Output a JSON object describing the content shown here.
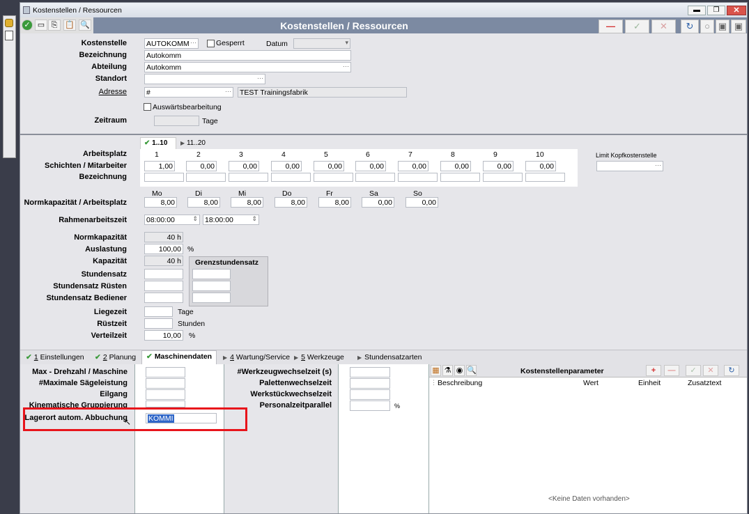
{
  "window": {
    "title": "Kostenstellen / Ressourcen",
    "header_title": "Kostenstellen / Ressourcen"
  },
  "colors": {
    "header_bg": "#7c8aa2",
    "panel_bg": "#e6e6ea",
    "accent_green": "#3a9a3a",
    "accent_red": "#d33030",
    "highlight_box": "#e8141b"
  },
  "form": {
    "kostenstelle_label": "Kostenstelle",
    "kostenstelle_value": "AUTOKOMM",
    "gesperrt_label": "Gesperrt",
    "datum_label": "Datum",
    "bezeichnung_label": "Bezeichnung",
    "bezeichnung_value": "Autokomm",
    "abteilung_label": "Abteilung",
    "abteilung_value": "Autokomm",
    "standort_label": "Standort",
    "adresse_label": "Adresse",
    "adresse_value": "#",
    "adresse_name": "TEST Trainingsfabrik",
    "auswaerts_label": "Auswärtsbearbeitung",
    "zeitraum_label": "Zeitraum",
    "zeitraum_unit": "Tage"
  },
  "shifts": {
    "tab1": "1..10",
    "tab2": "11..20",
    "arbeitsplatz_label": "Arbeitsplatz",
    "schichten_label": "Schichten / Mitarbeiter",
    "bezeichnung_label": "Bezeichnung",
    "numbers": [
      "1",
      "2",
      "3",
      "4",
      "5",
      "6",
      "7",
      "8",
      "9",
      "10"
    ],
    "values": [
      "1,00",
      "0,00",
      "0,00",
      "0,00",
      "0,00",
      "0,00",
      "0,00",
      "0,00",
      "0,00",
      "0,00"
    ],
    "limit_label": "Limit Kopfkostenstelle"
  },
  "weekdays": {
    "label": "Normkapazität / Arbeitsplatz",
    "days": [
      "Mo",
      "Di",
      "Mi",
      "Do",
      "Fr",
      "Sa",
      "So"
    ],
    "values": [
      "8,00",
      "8,00",
      "8,00",
      "8,00",
      "8,00",
      "0,00",
      "0,00"
    ]
  },
  "rahmen": {
    "label": "Rahmenarbeitszeit",
    "start": "08:00:00",
    "end": "18:00:00"
  },
  "capacity": {
    "normkap_label": "Normkapazität",
    "normkap_value": "40 h",
    "auslastung_label": "Auslastung",
    "auslastung_value": "100,00",
    "auslastung_unit": "%",
    "kapazitaet_label": "Kapazität",
    "kapazitaet_value": "40 h",
    "grenz_label": "Grenzstundensatz",
    "stundensatz_label": "Stundensatz",
    "stundensatz_ruesten_label": "Stundensatz Rüsten",
    "stundensatz_bediener_label": "Stundensatz Bediener",
    "liegezeit_label": "Liegezeit",
    "liegezeit_unit": "Tage",
    "ruestzeit_label": "Rüstzeit",
    "ruestzeit_unit": "Stunden",
    "verteilzeit_label": "Verteilzeit",
    "verteilzeit_value": "10,00",
    "verteilzeit_unit": "%"
  },
  "tabs": [
    {
      "num": "1",
      "label": " Einstellungen"
    },
    {
      "num": "2",
      "label": " Planung"
    },
    {
      "num": "",
      "label": "Maschinendaten"
    },
    {
      "num": "4",
      "label": " Wartung/Service"
    },
    {
      "num": "5",
      "label": " Werkzeuge"
    },
    {
      "num": "",
      "label": "Stundensatzarten"
    }
  ],
  "machine": {
    "max_drehzahl_label": "Max - Drehzahl / Maschine",
    "max_saege_label": "#Maximale Sägeleistung",
    "eilgang_label": "Eilgang",
    "kinematische_label": "Kinematische Gruppierung",
    "lagerort_label": "Lagerort autom. Abbuchung",
    "lagerort_value": "KOMMI",
    "werkzeug_label": "#Werkzeugwechselzeit (s)",
    "paletten_label": "Palettenwechselzeit",
    "werkstueck_label": "Werkstückwechselzeit",
    "personal_label": "Personalzeitparallel",
    "personal_unit": "%"
  },
  "params": {
    "title": "Kostenstellenparameter",
    "columns": [
      "Beschreibung",
      "Wert",
      "Einheit",
      "Zusatztext"
    ],
    "empty": "<Keine Daten vorhanden>"
  }
}
